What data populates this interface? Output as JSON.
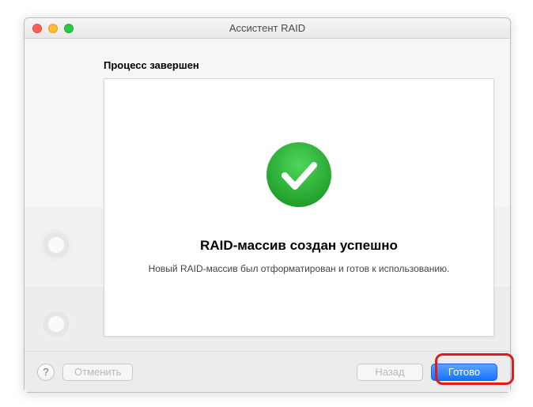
{
  "window": {
    "title": "Ассистент RAID"
  },
  "heading": "Процесс завершен",
  "message": {
    "title": "RAID-массив создан успешно",
    "subtitle": "Новый RAID-массив был отформатирован и готов к использованию."
  },
  "buttons": {
    "help": "?",
    "cancel": "Отменить",
    "back": "Назад",
    "done": "Готово"
  },
  "colors": {
    "success": "#2aa833",
    "primary": "#1a70ff",
    "highlight": "#e21a1a"
  }
}
